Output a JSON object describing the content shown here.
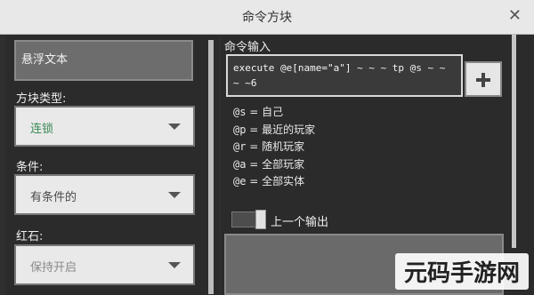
{
  "window": {
    "title": "命令方块",
    "close_symbol": "✕"
  },
  "left": {
    "hover_note_placeholder": "悬浮文本",
    "block_type": {
      "label": "方块类型:",
      "value": "连锁",
      "value_color": "#3a8a56"
    },
    "condition": {
      "label": "条件:",
      "value": "有条件的",
      "value_color": "#4a4a4a"
    },
    "redstone": {
      "label": "红石:",
      "value": "保持开启",
      "value_color": "#8a8a8a"
    }
  },
  "right": {
    "command_label": "命令输入",
    "command_text": "execute @e[name=\"a\"] ~ ~ ~ tp @s ~ ~ ~ ~6",
    "selectors": [
      {
        "key": "@s",
        "desc": "= 自己"
      },
      {
        "key": "@p",
        "desc": "= 最近的玩家"
      },
      {
        "key": "@r",
        "desc": "= 随机玩家"
      },
      {
        "key": "@a",
        "desc": "= 全部玩家"
      },
      {
        "key": "@e",
        "desc": "= 全部实体"
      }
    ],
    "previous_output_label": "上一个输出",
    "previous_output_on": true
  },
  "watermark": "元码手游网"
}
